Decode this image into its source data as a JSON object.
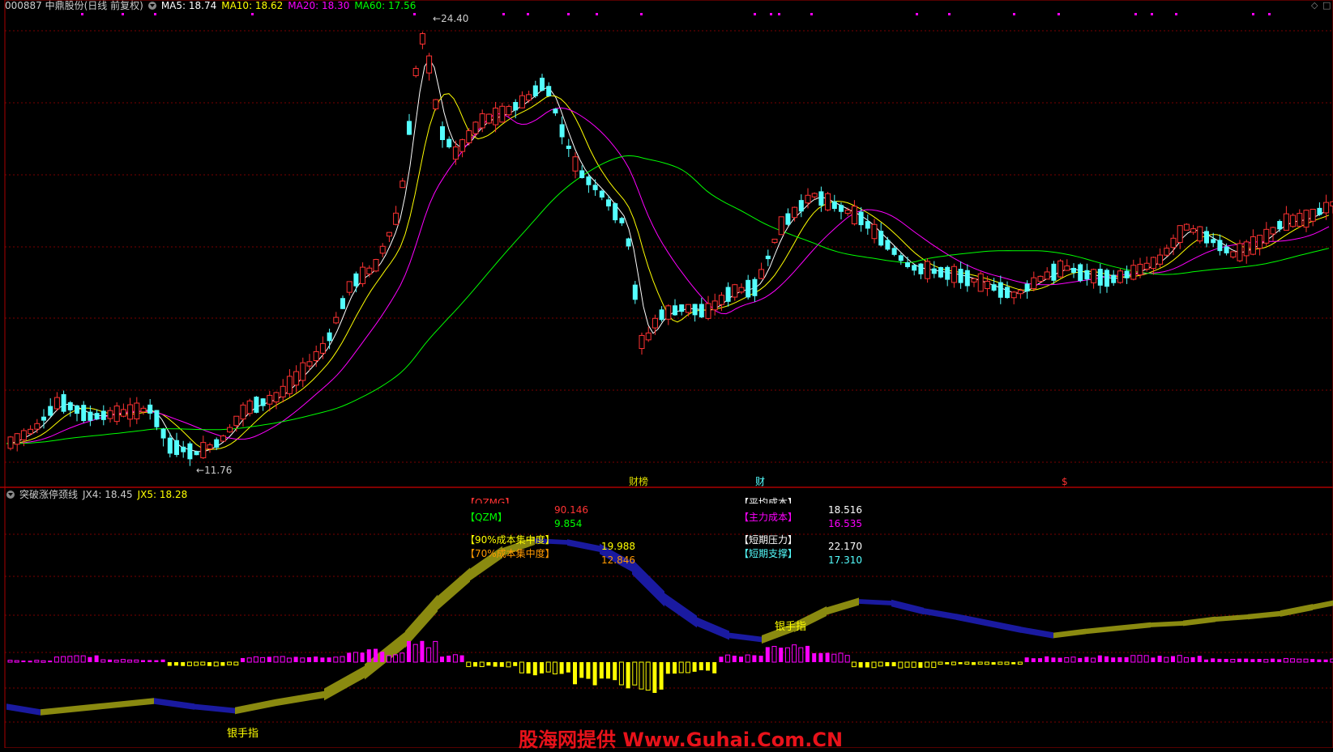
{
  "main_header": {
    "stock": "000887 中鼎股份(日线 前复权)",
    "ma5": "MA5: 18.74",
    "ma10": "MA10: 18.62",
    "ma20": "MA20: 18.30",
    "ma60": "MA60: 17.56"
  },
  "main_chart": {
    "high_label": "24.40",
    "low_label": "11.76",
    "markers": [
      "财榜",
      "财",
      "$"
    ]
  },
  "indicator_header": {
    "name": "突破涨停颈线",
    "jx4": "JX4: 18.45",
    "jx5": "JX5: 18.28"
  },
  "indicator_readouts": {
    "qzmg_label": "【QZMG】",
    "qzmg_value": "90.146",
    "qzm_label": "【QZM】",
    "qzm_value": "9.854",
    "c90_label": "【90%成本集中度】",
    "c90_value": "19.988",
    "c70_label": "【70%成本集中度】",
    "c70_value": "12.846",
    "avg_cost_label": "【平均成本】",
    "avg_cost_value": "18.516",
    "main_cost_label": "【主力成本】",
    "main_cost_value": "16.535",
    "short_pressure_label": "【短期压力】",
    "short_pressure_value": "22.170",
    "short_support_label": "【短期支撑】",
    "short_support_value": "17.310"
  },
  "indicator_labels": {
    "silver_hand_1": "银手指",
    "silver_hand_2": "银手指"
  },
  "watermark": "股海网提供 Www.Guhai.Com.CN",
  "colors": {
    "ma5": "#ffffff",
    "ma10": "#ffff00",
    "ma20": "#ff00ff",
    "ma60": "#00ff00",
    "up": "#ff3232",
    "down": "#54ffff",
    "band_up": "#8a8a10",
    "band_down": "#1a1aa0"
  }
}
